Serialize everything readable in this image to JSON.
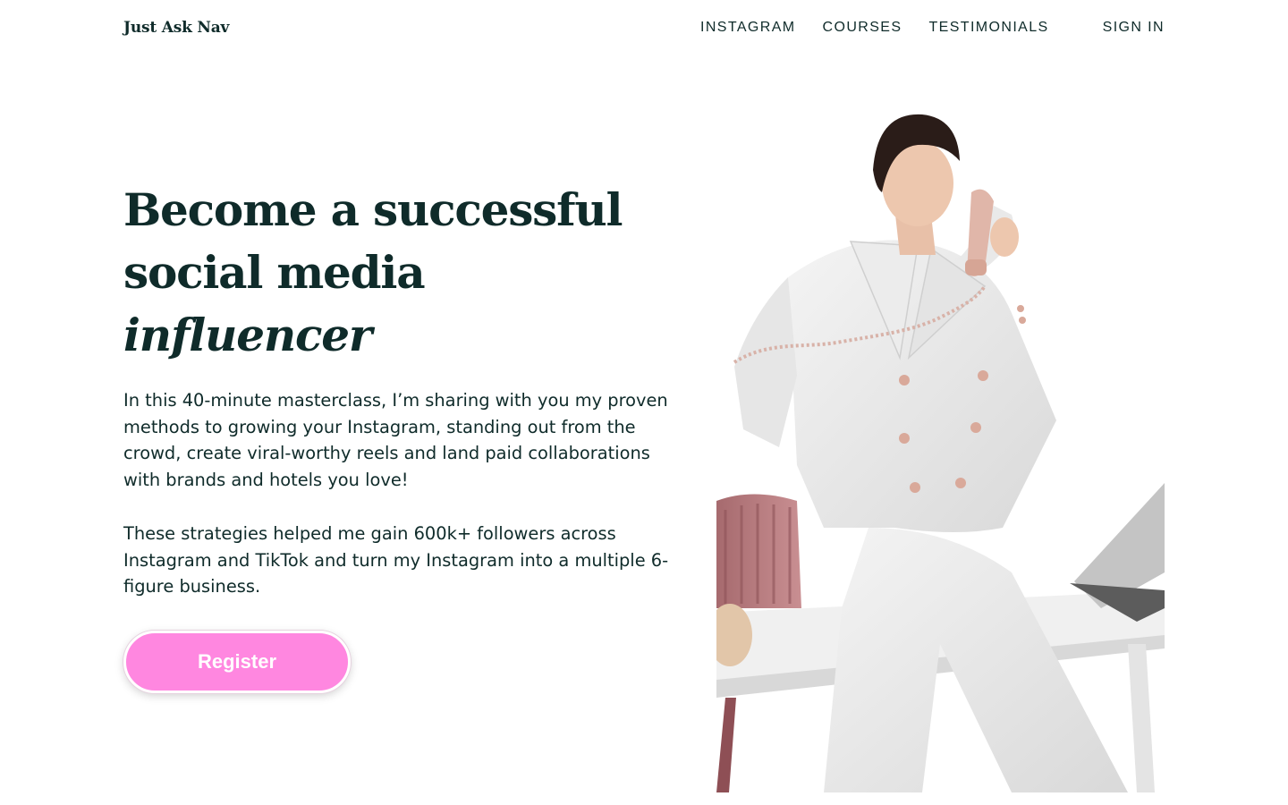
{
  "brand": {
    "name": "Just Ask Nav"
  },
  "nav": {
    "items": [
      {
        "label": "INSTAGRAM"
      },
      {
        "label": "COURSES"
      },
      {
        "label": "TESTIMONIALS"
      }
    ],
    "sign_in": "SIGN IN"
  },
  "hero": {
    "headline_line1": "Become a successful",
    "headline_line2_plain": "social media ",
    "headline_line2_em": "influencer",
    "paragraph1": "In this 40-minute masterclass, I’m sharing with you my proven methods to growing your Instagram, standing out from the crowd, create viral-worthy reels and land paid collaborations with brands and hotels you love!",
    "paragraph2": "These strategies helped me gain 600k+ followers across Instagram and TikTok and turn my Instagram into a multiple 6-figure business.",
    "cta_label": "Register"
  },
  "colors": {
    "text": "#0f2b2a",
    "cta": "#ff87e0",
    "background": "#ffffff"
  }
}
